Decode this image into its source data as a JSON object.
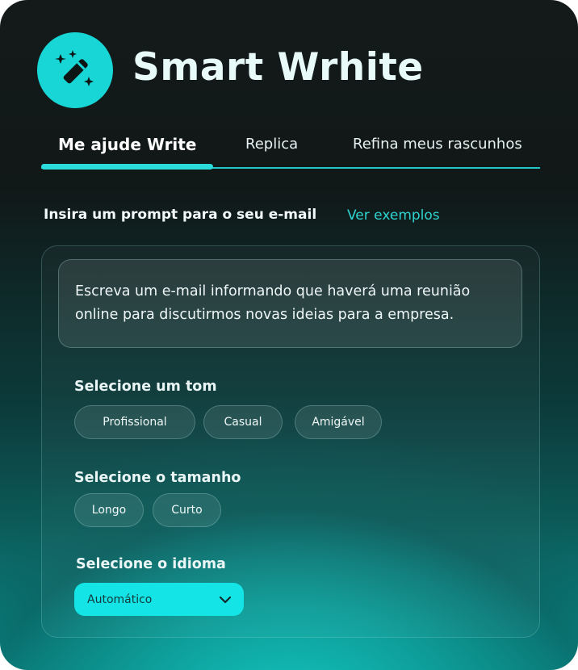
{
  "app": {
    "title": "Smart Wrhite",
    "logo_icon": "magic-wand-icon",
    "accent_color": "#19d6d6"
  },
  "tabs": [
    {
      "label": "Me ajude Write",
      "active": true
    },
    {
      "label": "Replica",
      "active": false
    },
    {
      "label": "Refina meus rascunhos",
      "active": false
    }
  ],
  "prompt": {
    "label": "Insira um prompt para o seu e-mail",
    "examples_link": "Ver exemplos",
    "text": "Escreva um e-mail informando que haverá uma reunião online para discutirmos novas ideias para a empresa."
  },
  "tone": {
    "label": "Selecione um tom",
    "options": [
      "Profissional",
      "Casual",
      "Amigável"
    ]
  },
  "size": {
    "label": "Selecione o tamanho",
    "options": [
      "Longo",
      "Curto"
    ]
  },
  "language": {
    "label": "Selecione o idioma",
    "selected": "Automático",
    "icon": "chevron-down-icon"
  }
}
